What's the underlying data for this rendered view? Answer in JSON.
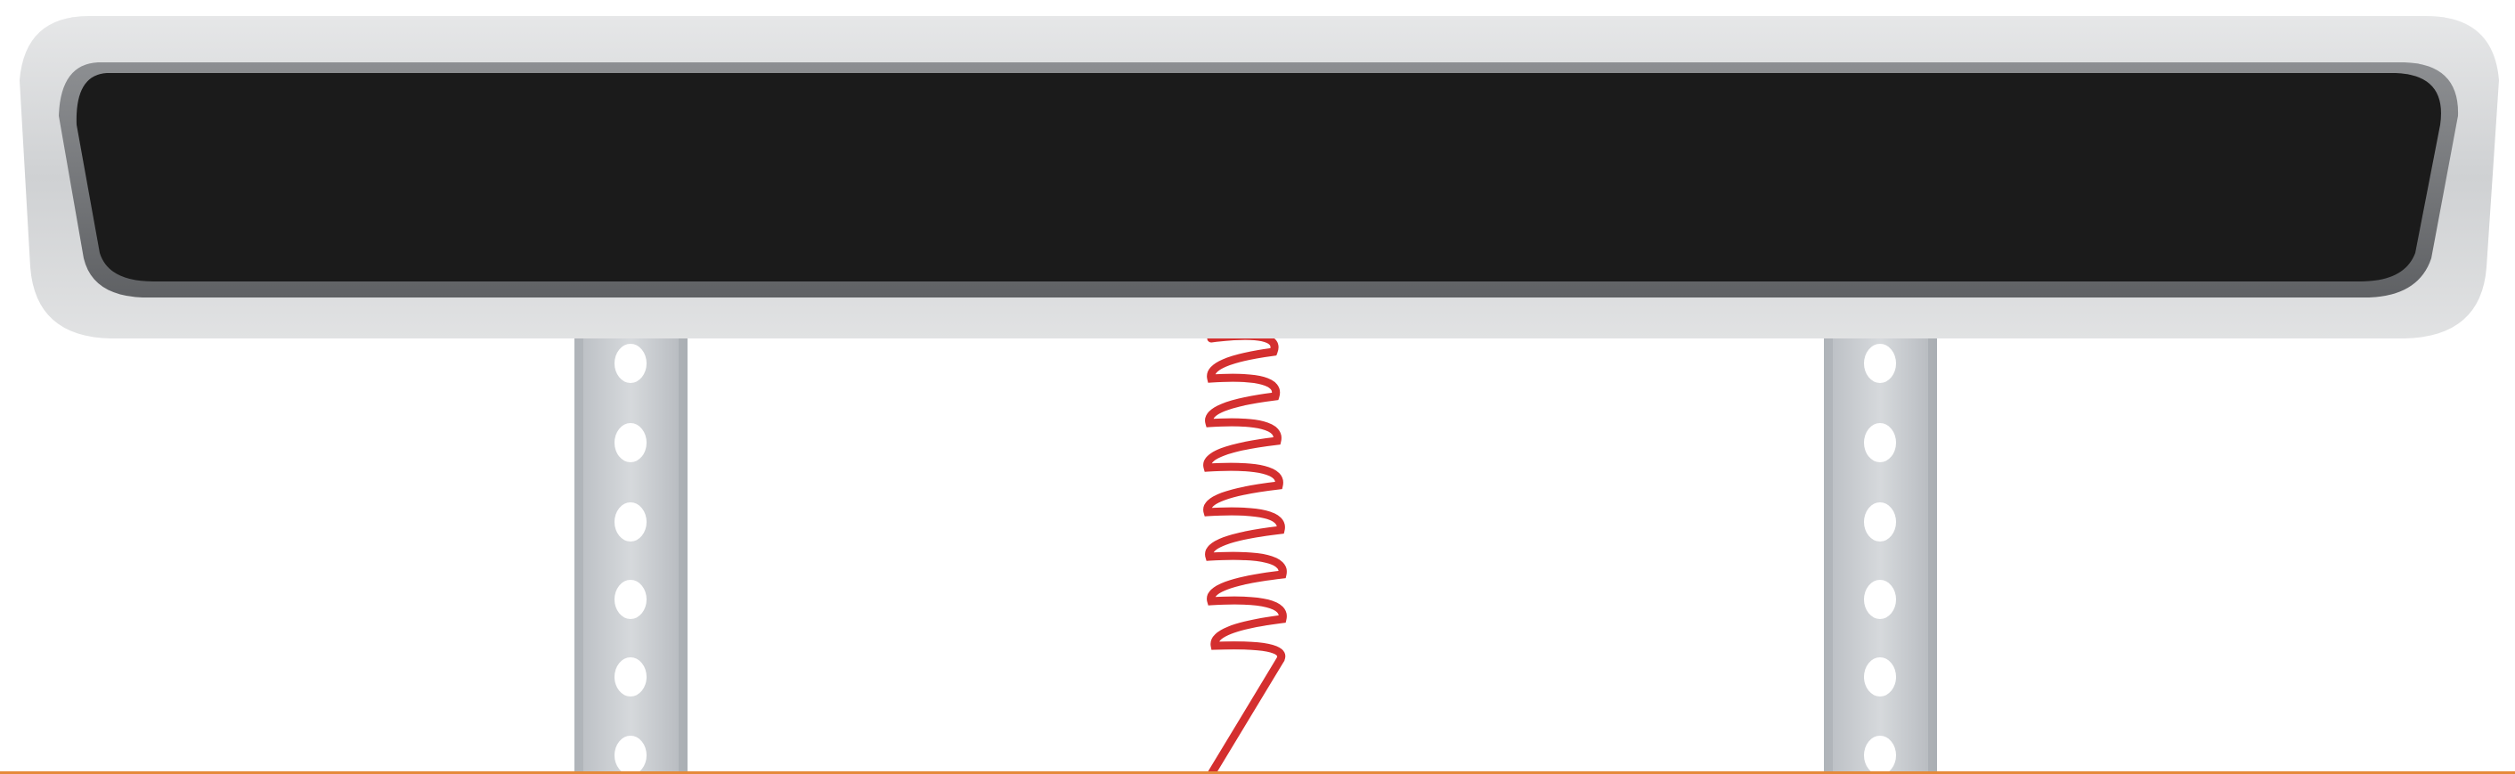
{
  "scene": {
    "description_label": "",
    "display": {
      "text": "",
      "panel_color": "#1b1b1b",
      "frame_color": "#d9dadb"
    },
    "posts": {
      "color": "#c9ccd0",
      "count": 2
    },
    "cable": {
      "color": "#d42f2f"
    },
    "ground": {
      "color": "#e58a3a"
    }
  }
}
